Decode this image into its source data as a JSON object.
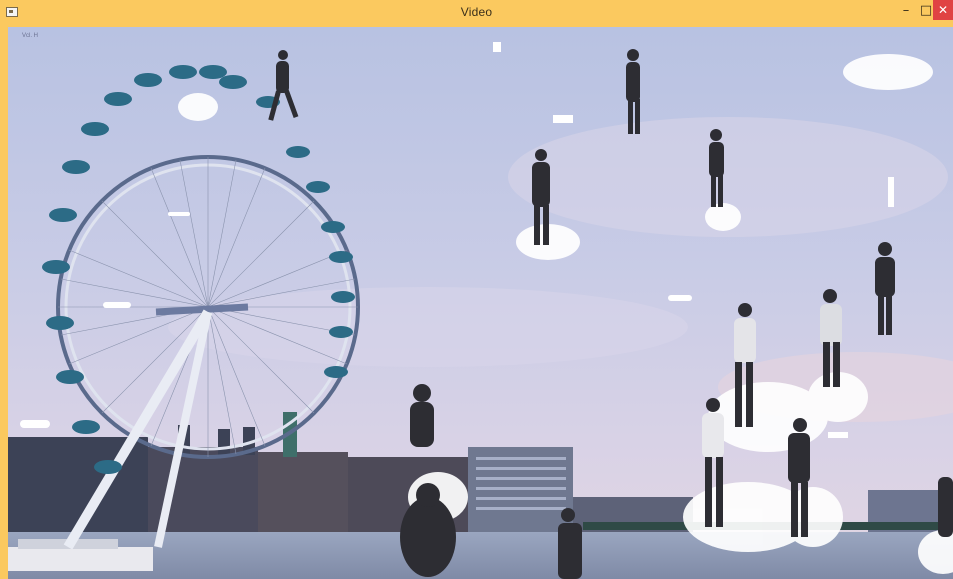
{
  "window": {
    "title": "Video",
    "app_icon": "window-icon",
    "controls": {
      "minimize": "–",
      "maximize": "□",
      "close": "✕"
    },
    "accent_color": "#fbc95f",
    "close_color": "#e04343"
  },
  "video": {
    "overlay_corner_text": "Vcl. H"
  }
}
